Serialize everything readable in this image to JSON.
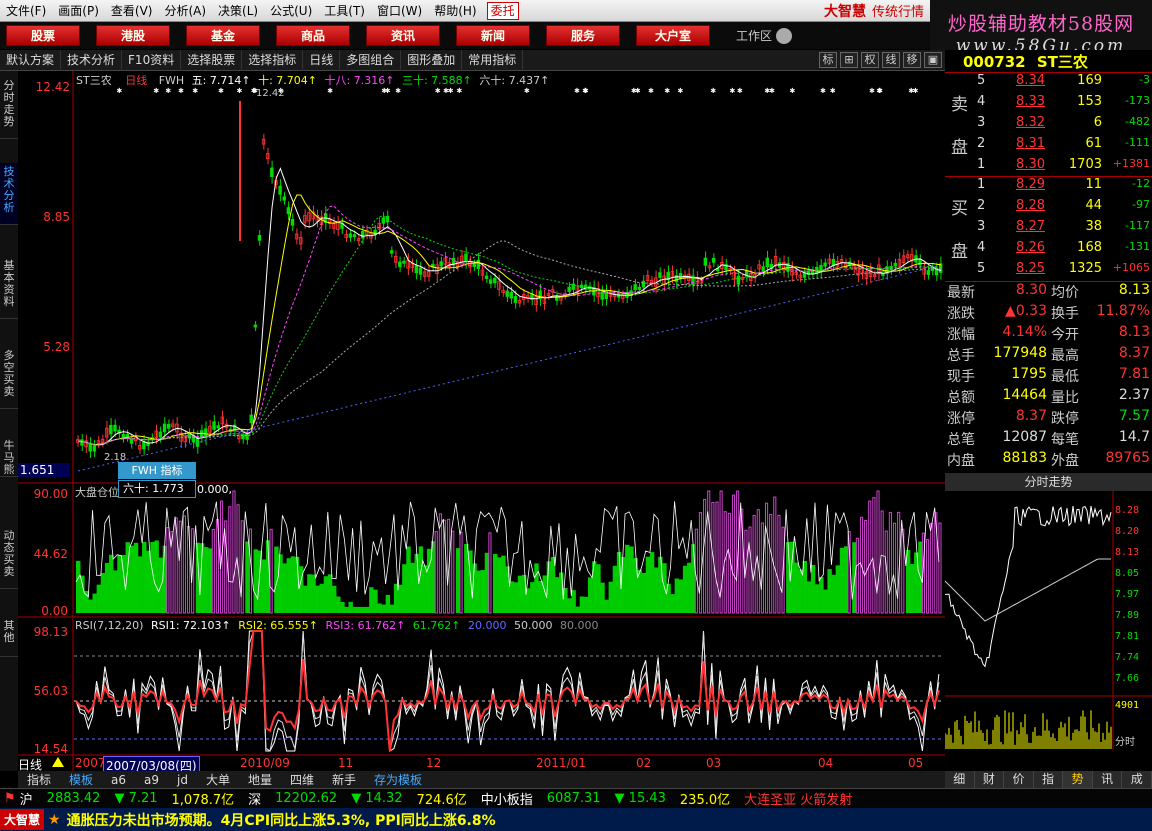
{
  "menu": {
    "items": [
      "文件(F)",
      "画面(P)",
      "查看(V)",
      "分析(A)",
      "决策(L)",
      "公式(U)",
      "工具(T)",
      "窗口(W)",
      "帮助(H)"
    ],
    "entrust": "委托",
    "brand": "大智慧",
    "brand_sub": "传统行情"
  },
  "watermark": {
    "line1": "炒股辅助教材58股网",
    "line2": "www.58Gu.com"
  },
  "nav": {
    "buttons": [
      "股票",
      "港股",
      "基金",
      "商品",
      "资讯",
      "新闻",
      "服务",
      "大户室"
    ],
    "workarea": "工作区"
  },
  "toolbar": {
    "items": [
      "默认方案",
      "技术分析",
      "F10资料",
      "选择股票",
      "选择指标",
      "日线",
      "多图组合",
      "图形叠加",
      "常用指标"
    ],
    "right_buttons": [
      "标",
      "",
      "权",
      "线",
      "移",
      ""
    ]
  },
  "left_tabs": [
    "分时走势",
    "技术分析",
    "基本资料",
    "多空买卖",
    "牛马熊",
    "动态买卖",
    "其他"
  ],
  "stock": {
    "code": "000732",
    "name": "ST三农"
  },
  "kline": {
    "legend": {
      "name": "ST三农",
      "period": "日线",
      "indicator": "FWH",
      "ma5": "五: 7.714↑",
      "ma10": "十: 7.704↑",
      "ma18": "十八: 7.316↑",
      "ma30": "三十: 7.588↑",
      "ma60": "六十: 7.437↑"
    },
    "price_axis": [
      "12.42",
      "8.85",
      "5.28",
      "1.651"
    ],
    "tooltip_title": "FWH 指标",
    "tooltip_value": "六十:  1.773",
    "tooltip_after": "0.000,",
    "low_label": "2.18",
    "high_label": "12.42"
  },
  "panel2": {
    "title": "大盘仓位",
    "axis": [
      "90.00",
      "44.62",
      "0.00"
    ]
  },
  "panel3": {
    "legend": {
      "name": "RSI(7,12,20)",
      "rsi1": "RSI1: 72.103↑",
      "rsi2": "RSI2: 65.555↑",
      "rsi3": "RSI3: 61.762↑",
      "extra": "61.762↑",
      "v20": "20.000",
      "v50": "50.000",
      "v80": "80.000"
    },
    "axis": [
      "98.13",
      "56.03",
      "14.54"
    ]
  },
  "date_axis": {
    "period": "日线",
    "selected": "2007/03/08(四)",
    "labels": [
      "2007",
      "2010/09",
      "11",
      "12",
      "2011/01",
      "02",
      "03",
      "04",
      "05"
    ]
  },
  "order_book": {
    "sell_label": [
      "卖",
      "盘"
    ],
    "buy_label": [
      "买",
      "盘"
    ],
    "sell": [
      {
        "lv": "5",
        "price": "8.34",
        "vol": "169",
        "chg": "-3"
      },
      {
        "lv": "4",
        "price": "8.33",
        "vol": "153",
        "chg": "-173"
      },
      {
        "lv": "3",
        "price": "8.32",
        "vol": "6",
        "chg": "-482"
      },
      {
        "lv": "2",
        "price": "8.31",
        "vol": "61",
        "chg": "-111"
      },
      {
        "lv": "1",
        "price": "8.30",
        "vol": "1703",
        "chg": "+1381"
      }
    ],
    "buy": [
      {
        "lv": "1",
        "price": "8.29",
        "vol": "11",
        "chg": "-12"
      },
      {
        "lv": "2",
        "price": "8.28",
        "vol": "44",
        "chg": "-97"
      },
      {
        "lv": "3",
        "price": "8.27",
        "vol": "38",
        "chg": "-117"
      },
      {
        "lv": "4",
        "price": "8.26",
        "vol": "168",
        "chg": "-131"
      },
      {
        "lv": "5",
        "price": "8.25",
        "vol": "1325",
        "chg": "+1065"
      }
    ]
  },
  "stats": [
    {
      "l1": "最新",
      "v1": "8.30",
      "l2": "均价",
      "v2": "8.13"
    },
    {
      "l1": "涨跌",
      "v1": "▲0.33",
      "l2": "换手",
      "v2": "11.87%"
    },
    {
      "l1": "涨幅",
      "v1": "4.14%",
      "l2": "今开",
      "v2": "8.13"
    },
    {
      "l1": "总手",
      "v1": "177948",
      "l2": "最高",
      "v2": "8.37"
    },
    {
      "l1": "现手",
      "v1": "1795",
      "l2": "最低",
      "v2": "7.81"
    },
    {
      "l1": "总额",
      "v1": "14464",
      "l2": "量比",
      "v2": "2.37"
    },
    {
      "l1": "涨停",
      "v1": "8.37",
      "l2": "跌停",
      "v2": "7.57"
    },
    {
      "l1": "总笔",
      "v1": "12087",
      "l2": "每笔",
      "v2": "14.7"
    },
    {
      "l1": "内盘",
      "v1": "88183",
      "l2": "外盘",
      "v2": "89765"
    }
  ],
  "intraday": {
    "title": "分时走势",
    "axis": [
      "8.28",
      "8.20",
      "8.13",
      "8.05",
      "7.97",
      "7.89",
      "7.81",
      "7.74",
      "7.66"
    ],
    "vol_axis": "4901",
    "bottom_label": "分时"
  },
  "bottom_tabs": [
    "指标",
    "模板",
    "a6",
    "a9",
    "jd",
    "大单",
    "地量",
    "四维",
    "新手",
    "存为模板"
  ],
  "right_tabs": [
    "细",
    "财",
    "价",
    "指",
    "势",
    "讯",
    "成"
  ],
  "index_bar": [
    {
      "name": "沪",
      "value": "2883.42",
      "chg": "▼ 7.21",
      "amt": "1,078.7亿"
    },
    {
      "name": "深",
      "value": "12202.62",
      "chg": "▼ 14.32",
      "amt": "724.6亿"
    },
    {
      "name": "中小板指",
      "value": "6087.31",
      "chg": "▼ 15.43",
      "amt": "235.0亿"
    }
  ],
  "index_news": "大连圣亚 火箭发射",
  "news": {
    "logo": "大智慧",
    "text": "通胀压力未出市场预期。4月CPI同比上涨5.3%, PPI同比上涨6.8%"
  },
  "colors": {
    "up": "#ff3333",
    "down": "#00dd00",
    "accent": "#ffff00",
    "purple": "#cc44cc"
  }
}
